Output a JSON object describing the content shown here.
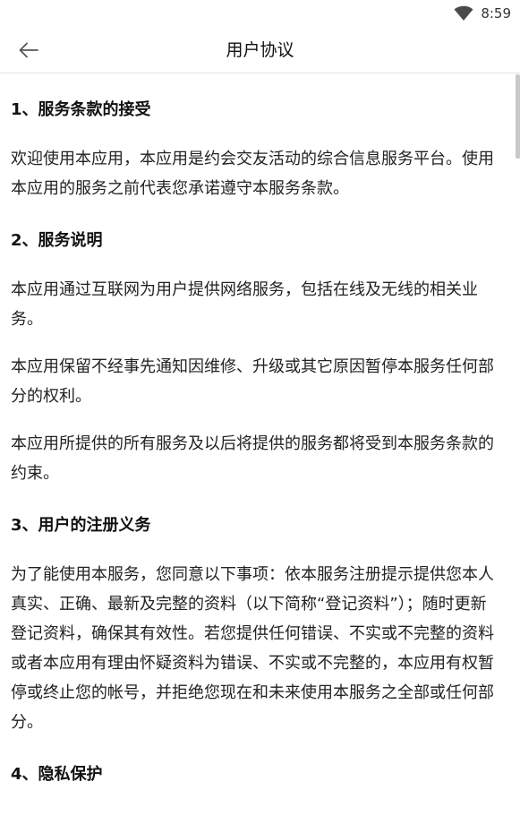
{
  "status_bar": {
    "time": "8:59",
    "icons": [
      "wifi-icon"
    ]
  },
  "app_bar": {
    "title": "用户协议",
    "back_icon": "arrow-left-icon"
  },
  "sections": [
    {
      "heading": "1、服务条款的接受",
      "paragraphs": [
        "欢迎使用本应用，本应用是约会交友活动的综合信息服务平台。使用本应用的服务之前代表您承诺遵守本服务条款。"
      ]
    },
    {
      "heading": "2、服务说明",
      "paragraphs": [
        "本应用通过互联网为用户提供网络服务，包括在线及无线的相关业务。",
        "本应用保留不经事先通知因维修、升级或其它原因暂停本服务任何部分的权利。",
        "本应用所提供的所有服务及以后将提供的服务都将受到本服务条款的约束。"
      ]
    },
    {
      "heading": "3、用户的注册义务",
      "paragraphs": [
        "为了能使用本服务，您同意以下事项：依本服务注册提示提供您本人真实、正确、最新及完整的资料（以下简称“登记资料”）；随时更新登记资料，确保其有效性。若您提供任何错误、不实或不完整的资料或者本应用有理由怀疑资料为错误、不实或不完整的，本应用有权暂停或终止您的帐号，并拒绝您现在和未来使用本服务之全部或任何部分。"
      ]
    },
    {
      "heading": "4、隐私保护",
      "paragraphs": []
    }
  ]
}
